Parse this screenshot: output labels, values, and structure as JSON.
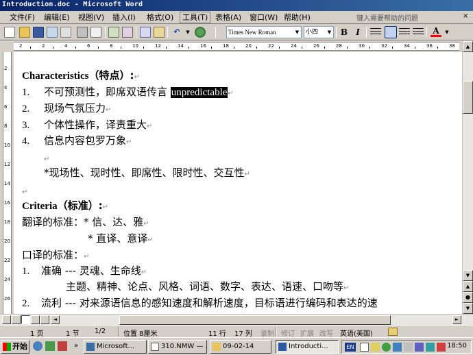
{
  "window": {
    "title": "Introduction.doc - Microsoft Word"
  },
  "menu": {
    "items": [
      "文件(F)",
      "编辑(E)",
      "视图(V)",
      "插入(I)",
      "格式(O)",
      "工具(T)",
      "表格(A)",
      "窗口(W)",
      "帮助(H)"
    ],
    "help_search_placeholder": "键入需要帮助的问题",
    "close_glyph": "×"
  },
  "toolbar": {
    "font_name": "Times New Roman",
    "font_size": "小四",
    "bold_label": "B",
    "italic_label": "I",
    "font_color_label": "A",
    "font_color": "#ff0000"
  },
  "ruler": {
    "numbers": [
      "2",
      "2",
      "4",
      "6",
      "8",
      "10",
      "12",
      "14",
      "16",
      "18",
      "20",
      "22",
      "24",
      "26",
      "28",
      "30",
      "32",
      "34",
      "36",
      "38"
    ]
  },
  "vruler": {
    "numbers": [
      "2",
      "4",
      "6",
      "8",
      "10",
      "12",
      "14",
      "16",
      "18",
      "20",
      "22",
      "24",
      "26"
    ]
  },
  "document": {
    "characteristics_heading_en": "Characteristics",
    "characteristics_heading_cn": "（特点）:",
    "char_items": [
      {
        "num": "1.",
        "text": "不可预测性，即席双语传言 ",
        "selected": "unpredictable"
      },
      {
        "num": "2.",
        "text": "现场气氛压力"
      },
      {
        "num": "3.",
        "text": "个体性操作，译责重大"
      },
      {
        "num": "4.",
        "text": "信息内容包罗万象"
      }
    ],
    "star_line": "*现场性、现时性、即席性、限时性、交互性",
    "criteria_heading_en": "Criteria",
    "criteria_heading_cn": "（标准）:",
    "translation_standard": "翻译的标准：* 信、达、雅",
    "translation_standard_2": "* 直译、意译",
    "interpretation_standard": "口译的标准：",
    "criteria_items": [
      {
        "num": "1.",
        "text": "准确 --- 灵魂、生命线"
      },
      {
        "num": "",
        "text": "主题、精神、论点、风格、词语、数字、表达、语速、口吻等"
      },
      {
        "num": "2.",
        "text": "流利 --- 对来源语信息的感知速度和解析速度，目标语进行编码和表达的速"
      }
    ],
    "paragraph_mark": "↵"
  },
  "statusbar": {
    "page": "1 页",
    "section": "1 节",
    "page_of": "1/2",
    "position": "位置 8厘米",
    "line": "11 行",
    "column": "17 列",
    "rec": "录制",
    "trk": "修订",
    "ext": "扩展",
    "ovr": "改写",
    "language": "英语(美国)"
  },
  "taskbar": {
    "start_label": "开始",
    "tasks": [
      "Microsoft...",
      "310.NMW — ...",
      "09-02-14",
      "Introducti..."
    ],
    "ime_label": "EN",
    "clock": "18:50"
  }
}
